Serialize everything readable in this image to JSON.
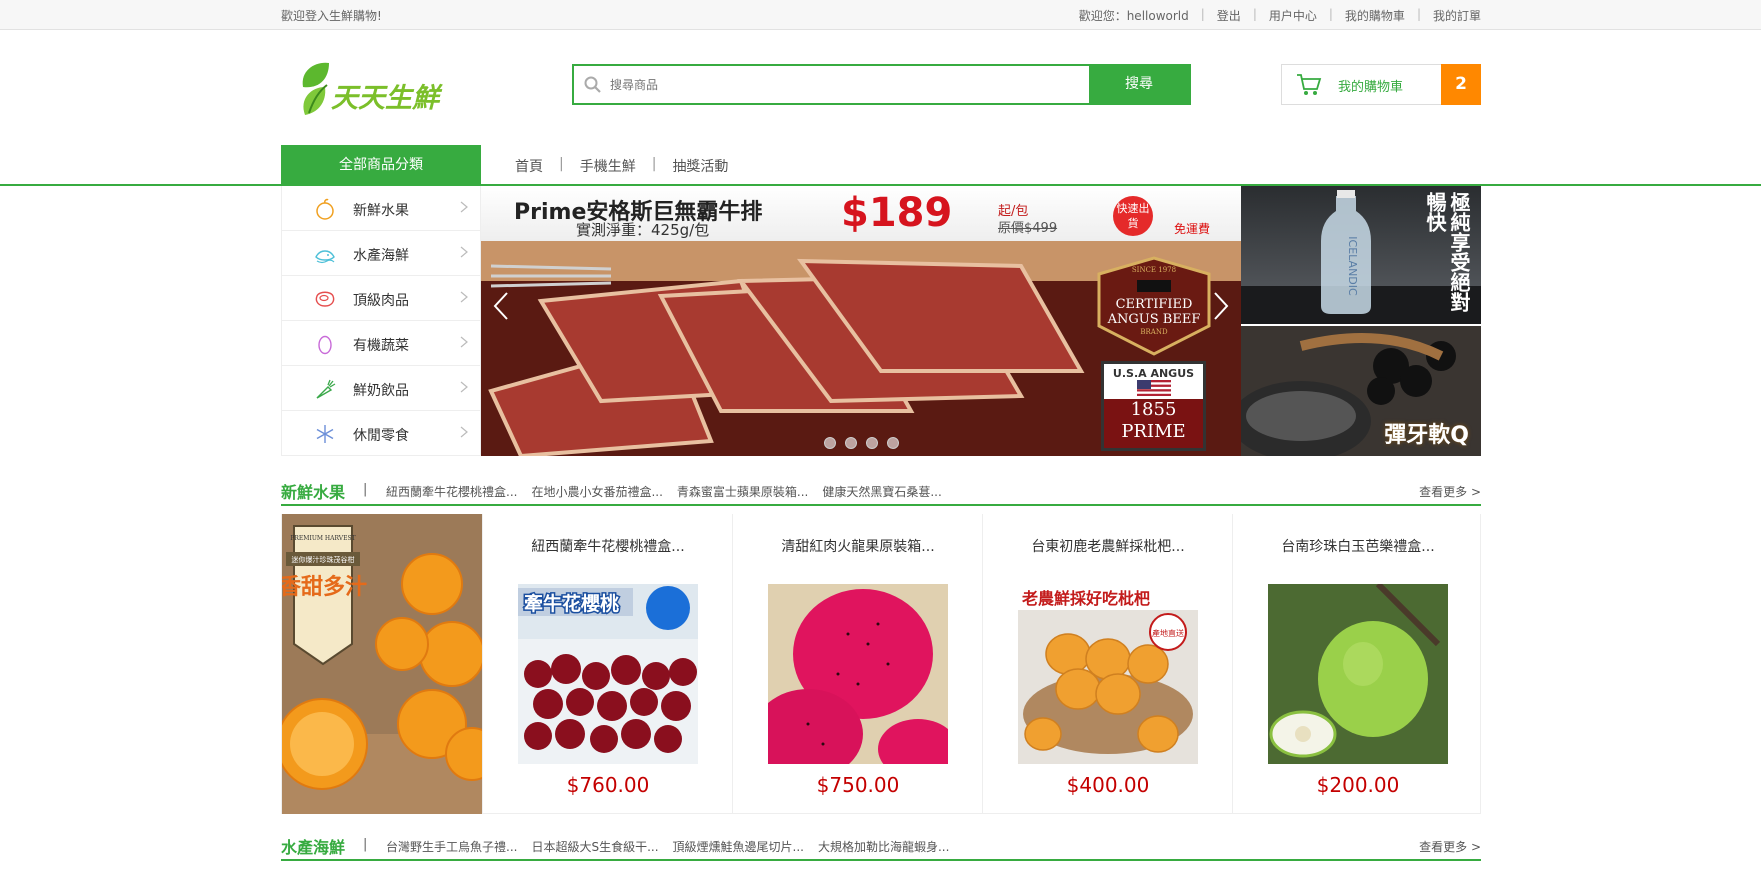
{
  "topbar": {
    "welcome": "歡迎登入生鮮購物!",
    "greeting": "歡迎您：helloworld",
    "logout": "登出",
    "user_center": "用户中心",
    "my_cart": "我的購物車",
    "my_orders": "我的訂單"
  },
  "logo": {
    "text": "天天生鮮"
  },
  "search": {
    "placeholder": "搜尋商品",
    "button": "搜尋"
  },
  "cart": {
    "label": "我的購物車",
    "count": "2"
  },
  "nav": {
    "all_categories": "全部商品分類",
    "menu": [
      "首頁",
      "手機生鮮",
      "抽獎活動"
    ]
  },
  "categories": [
    {
      "label": "新鮮水果",
      "icon": "orange-icon"
    },
    {
      "label": "水產海鮮",
      "icon": "fish-icon"
    },
    {
      "label": "頂級肉品",
      "icon": "meat-icon"
    },
    {
      "label": "有機蔬菜",
      "icon": "egg-icon"
    },
    {
      "label": "鮮奶飲品",
      "icon": "carrot-icon"
    },
    {
      "label": "休閒零食",
      "icon": "snowflake-icon"
    }
  ],
  "banner": {
    "title": "Prime安格斯巨無霸牛排",
    "subtitle": "實測淨重：425g/包",
    "price": "$189",
    "unit": "起/包",
    "original": "原價$499",
    "fast_ship": "快速出貨",
    "free_ship": "免運費",
    "badge1": [
      "SINCE 1978",
      "CERTIFIED",
      "ANGUS BEEF",
      "BRAND"
    ],
    "badge2": [
      "U.S.A ANGUS",
      "1855",
      "PRIME"
    ],
    "slides": 4
  },
  "ads": {
    "ad1_text": "極純享受絕對暢快",
    "ad1_brand": "ICELANDIC",
    "ad2_text": "彈牙軟Q"
  },
  "floors": [
    {
      "title": "新鮮水果",
      "subs": [
        "紐西蘭牽牛花櫻桃禮盒...",
        "在地小農小女番茄禮盒...",
        "青森蜜富士蘋果原裝箱...",
        "健康天然黑寶石桑葚..."
      ],
      "more": "查看更多 >",
      "promo": {
        "top": "PREMIUM HARVEST",
        "ribbon": "迷你爆汁珍珠茂谷柑",
        "text": "香甜多汁"
      },
      "goods": [
        {
          "name": "紐西蘭牽牛花櫻桃禮盒...",
          "price": "$760.00",
          "tag": "牽牛花櫻桃"
        },
        {
          "name": "清甜紅肉火龍果原裝箱...",
          "price": "$750.00"
        },
        {
          "name": "台東初鹿老農鮮採枇杷...",
          "price": "$400.00",
          "tag": "老農鮮採好吃枇杷",
          "stamp": "產地直送"
        },
        {
          "name": "台南珍珠白玉芭樂禮盒...",
          "price": "$200.00"
        }
      ]
    },
    {
      "title": "水產海鮮",
      "subs": [
        "台灣野生手工烏魚子禮...",
        "日本超級大S生食級干...",
        "頂級煙燻鮭魚邊尾切片...",
        "大規格加勒比海龍蝦身..."
      ],
      "more": "查看更多 >"
    }
  ],
  "colors": {
    "brand_green": "#37ab40",
    "cart_orange": "#ff8800",
    "price_red": "#c40000"
  }
}
